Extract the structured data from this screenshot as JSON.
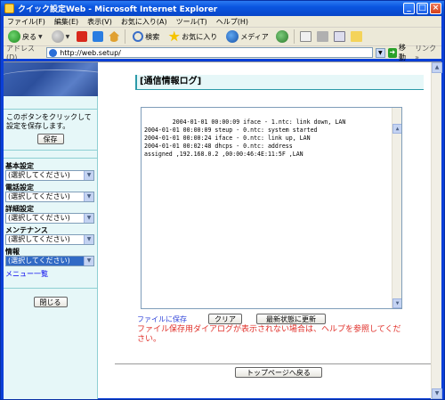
{
  "window": {
    "title": "クイック設定Web - Microsoft Internet Explorer"
  },
  "menubar": [
    "ファイル(F)",
    "編集(E)",
    "表示(V)",
    "お気に入り(A)",
    "ツール(T)",
    "ヘルプ(H)"
  ],
  "toolbar": {
    "back_label": "戻る",
    "search_label": "検索",
    "favorites_label": "お気に入り",
    "media_label": "メディア"
  },
  "address": {
    "label": "アドレス(D)",
    "url": "http://web.setup/",
    "go_label": "移動",
    "links_label": "リンク »"
  },
  "sidebar": {
    "save_hint": "このボタンをクリックして設定を保存します。",
    "save_label": "保存",
    "nav": [
      {
        "label": "基本設定",
        "value": "(選択してください)"
      },
      {
        "label": "電話設定",
        "value": "(選択してください)"
      },
      {
        "label": "詳細設定",
        "value": "(選択してください)"
      },
      {
        "label": "メンテナンス",
        "value": "(選択してください)"
      },
      {
        "label": "情報",
        "value": "(選択してください)"
      }
    ],
    "menu_list_link": "メニュー一覧",
    "close_label": "閉じる"
  },
  "main": {
    "title": "[通信情報ログ]",
    "log_text": "2004-01-01 00:00:09 iface - 1.ntc: link down, LAN\n2004-01-01 00:00:09 steup - 0.ntc: system started\n2004-01-01 00:00:24 iface - 0.ntc: link up, LAN\n2004-01-01 00:02:48 dhcps - 0.ntc: address\nassigned ,192.168.0.2 ,00:00:46:4E:11:5F ,LAN",
    "file_save_link": "ファイルに保存",
    "clear_label": "クリア",
    "refresh_label": "最新状態に更新",
    "note": "ファイル保存用ダイアログが表示されない場合は、ヘルプを参照してください。",
    "top_page_label": "トップページへ戻る"
  }
}
